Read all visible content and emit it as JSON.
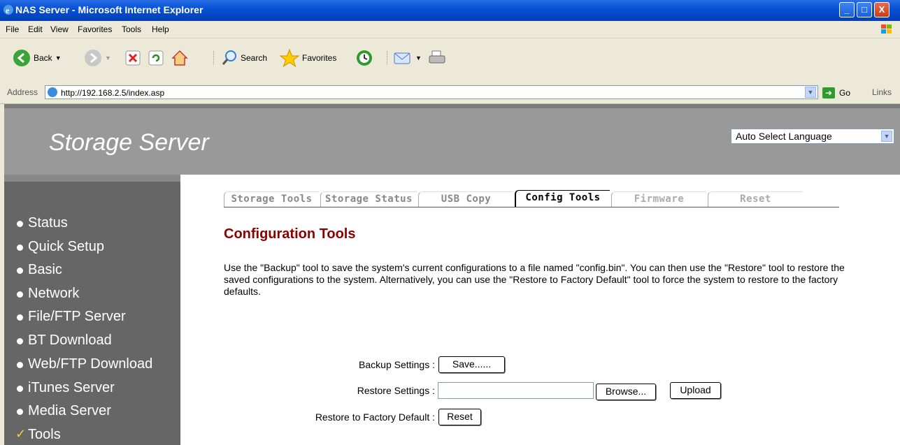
{
  "window": {
    "title": "NAS Server - Microsoft Internet Explorer",
    "min_label": "_",
    "max_label": "□",
    "close_label": "X"
  },
  "menu": [
    "File",
    "Edit",
    "View",
    "Favorites",
    "Tools",
    "Help"
  ],
  "toolbar": {
    "back_label": "Back",
    "search_label": "Search",
    "favorites_label": "Favorites"
  },
  "address": {
    "label": "Address",
    "url": "http://192.168.2.5/index.asp",
    "go_label": "Go",
    "links_label": "Links"
  },
  "header": {
    "brand": "Storage Server",
    "language_selected": "Auto Select Language"
  },
  "sidebar": {
    "items": [
      {
        "label": "Status"
      },
      {
        "label": "Quick Setup"
      },
      {
        "label": "Basic"
      },
      {
        "label": "Network"
      },
      {
        "label": "File/FTP Server"
      },
      {
        "label": "BT Download"
      },
      {
        "label": "Web/FTP Download"
      },
      {
        "label": "iTunes Server"
      },
      {
        "label": "Media Server"
      },
      {
        "label": "Tools"
      }
    ]
  },
  "tabs": [
    "Storage Tools",
    "Storage Status",
    "USB Copy",
    "Config Tools",
    "Firmware",
    "Reset"
  ],
  "main": {
    "title": "Configuration Tools",
    "description": "Use the \"Backup\" tool to save the system's current configurations to a file named \"config.bin\". You can then use the \"Restore\" tool to restore the saved configurations to the system. Alternatively, you can use the \"Restore to Factory Default\" tool to force the system to restore to the factory defaults.",
    "backup_label": "Backup Settings :",
    "save_button": "Save......",
    "restore_label": "Restore Settings :",
    "restore_value": "",
    "browse_button": "Browse...",
    "upload_button": "Upload",
    "factory_label": "Restore to Factory Default :",
    "reset_button": "Reset"
  },
  "colors": {
    "title_red": "#8b0000",
    "header_gray": "#999999",
    "sidebar_gray": "#666666",
    "check_yellow": "#f0d040"
  }
}
